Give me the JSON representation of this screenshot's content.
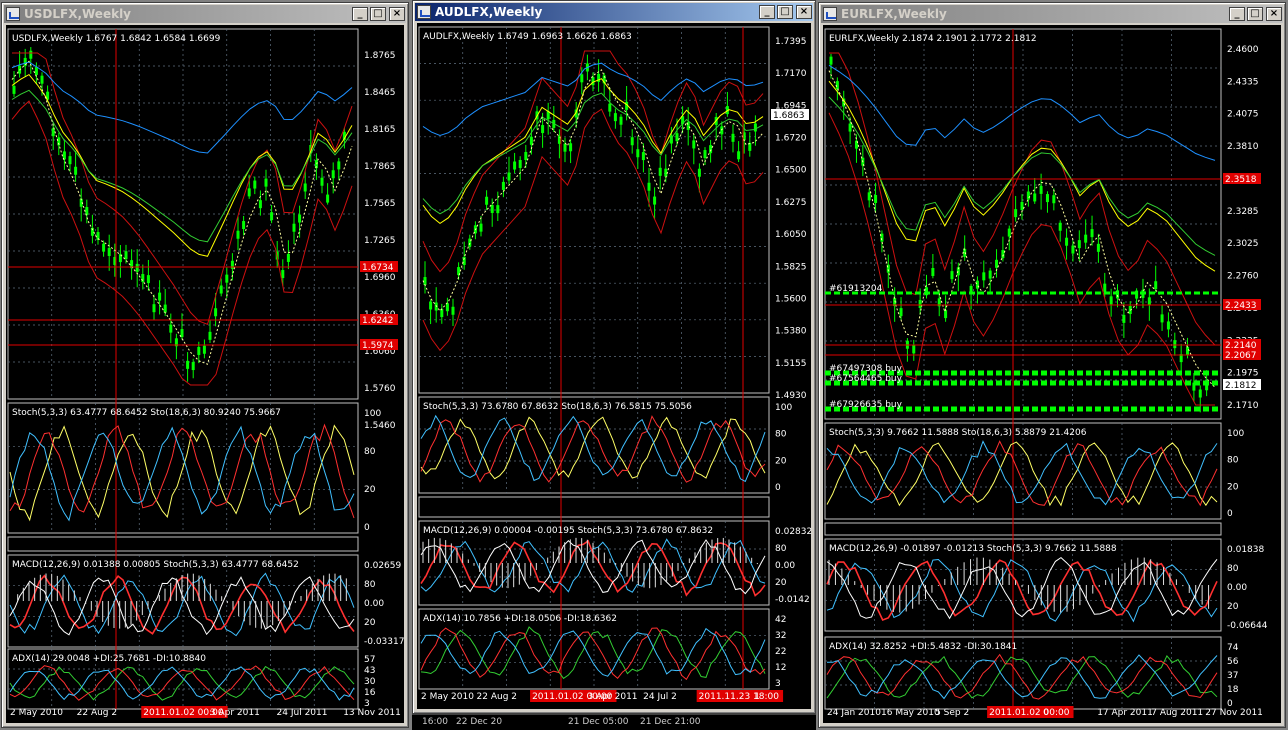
{
  "colors": {
    "candle": "#00ff00",
    "grid": "#607080",
    "sma_yellow": "#ffff00",
    "sma_blue": "#1e90ff",
    "sma_green": "#32cd32",
    "bands_red": "#cc1010",
    "stoch_main": "#ffff66",
    "stoch_sig": "#ff3030",
    "stoch_aqua": "#40c0ff",
    "hline": "#e00000",
    "tag_bg": "#e00000",
    "window_active": "#0a246a"
  },
  "windows": [
    {
      "id": "usd",
      "title": "USDLFX,Weekly",
      "active": false,
      "main": {
        "label": "USDLFX,Weekly  1.6767 1.6842 1.6584 1.6699",
        "axis": [
          "1.8765",
          "1.8465",
          "1.8165",
          "1.7865",
          "1.7565",
          "1.7265",
          "1.6960",
          "1.6360",
          "1.6060",
          "1.5760",
          "1.5460"
        ],
        "tags": [
          {
            "text": "1.6734",
            "hl": true
          },
          {
            "text": "1.6242",
            "hl": true
          },
          {
            "text": "1.5974",
            "hl": true
          }
        ],
        "labels": []
      },
      "sub": [
        {
          "label": "Stoch(5,3,3) 63.4777 68.6452   Sto(18,6,3) 80.9240 75.9667",
          "axis": [
            "100",
            "80",
            "20",
            "0"
          ]
        },
        {
          "label": "MACD(12,26,9) 0.01388 0.00805   Stoch(5,3,3) 63.4777 68.6452",
          "axis": [
            "0.02659",
            "80",
            "0.00",
            "20",
            "-0.03317"
          ]
        },
        {
          "label": "ADX(14) 29.0048 +DI:25.7681 -DI:10.8840",
          "axis": [
            "57",
            "43",
            "30",
            "16",
            "3"
          ]
        }
      ],
      "xaxis": [
        "2 May 2010",
        "22 Aug 2",
        "2011.01.02 00:00",
        "3 Apr 2011",
        "24 Jul 2011",
        "13 Nov 2011"
      ],
      "xhl": [
        2
      ]
    },
    {
      "id": "aud",
      "title": "AUDLFX,Weekly",
      "active": true,
      "main": {
        "label": "AUDLFX,Weekly  1.6749 1.6963 1.6626 1.6863",
        "axis": [
          "1.7395",
          "1.7170",
          "1.6945",
          "1.6720",
          "1.6500",
          "1.6275",
          "1.6050",
          "1.5825",
          "1.5600",
          "1.5380",
          "1.5155",
          "1.4930"
        ],
        "tags": [
          {
            "text": "1.6863",
            "hl": false
          }
        ],
        "labels": []
      },
      "sub": [
        {
          "label": "Stoch(5,3,3) 73.6780 67.8632   Sto(18,6,3) 76.5815 75.5056",
          "axis": [
            "100",
            "80",
            "20",
            "0"
          ]
        },
        {
          "label": "MACD(12,26,9) 0.00004 -0.00195   Stoch(5,3,3) 73.6780 67.8632",
          "axis": [
            "0.02832",
            "80",
            "0.00",
            "20",
            "-0.0142"
          ]
        },
        {
          "label": "ADX(14) 10.7856 +DI:18.0506 -DI:18.6362",
          "axis": [
            "42",
            "32",
            "22",
            "12",
            "3"
          ]
        }
      ],
      "xaxis": [
        "2 May 2010",
        "22 Aug 2",
        "2011.01.02 00:00",
        "3 Apr 2011",
        "24 Jul 2",
        "2011.11.23 18:00",
        "1"
      ],
      "xhl": [
        2,
        5
      ],
      "under": [
        "16:00",
        "22 Dec 20",
        "21 Dec 05:00",
        "21 Dec 21:00"
      ]
    },
    {
      "id": "eur",
      "title": "EURLFX,Weekly",
      "active": false,
      "main": {
        "label": "EURLFX,Weekly  2.1874 2.1901 2.1772 2.1812",
        "axis": [
          "2.4600",
          "2.4335",
          "2.4075",
          "2.3810",
          "2.3545",
          "2.3285",
          "2.3025",
          "2.2760",
          "2.2495",
          "2.2235",
          "2.1975",
          "2.1710"
        ],
        "tags": [
          {
            "text": "2.3518",
            "hl": true
          },
          {
            "text": "2.2433",
            "hl": true
          },
          {
            "text": "2.2140",
            "hl": true
          },
          {
            "text": "2.2067",
            "hl": true
          },
          {
            "text": "2.1812",
            "hl": false
          }
        ],
        "labels": [
          "#61913204",
          "#67497308 buy",
          "#67564465 buy",
          "#67926635 buy"
        ]
      },
      "sub": [
        {
          "label": "Stoch(5,3,3) 9.7662 11.5888   Sto(18,6,3) 5.8879 21.4206",
          "axis": [
            "100",
            "80",
            "20",
            "0"
          ]
        },
        {
          "label": "MACD(12,26,9) -0.01897 -0.01213   Stoch(5,3,3) 9.7662 11.5888",
          "axis": [
            "0.01838",
            "80",
            "0.00",
            "20",
            "-0.06644"
          ]
        },
        {
          "label": "ADX(14) 32.8252 +DI:5.4832 -DI:30.1841",
          "axis": [
            "74",
            "56",
            "37",
            "18",
            "0"
          ]
        }
      ],
      "xaxis": [
        "24 Jan 2010",
        "16 May 2010",
        "5 Sep 2",
        "2011.01.02 00:00",
        "0",
        "17 Apr 2011",
        "7 Aug 2011",
        "27 Nov 2011"
      ],
      "xhl": [
        3
      ]
    }
  ]
}
